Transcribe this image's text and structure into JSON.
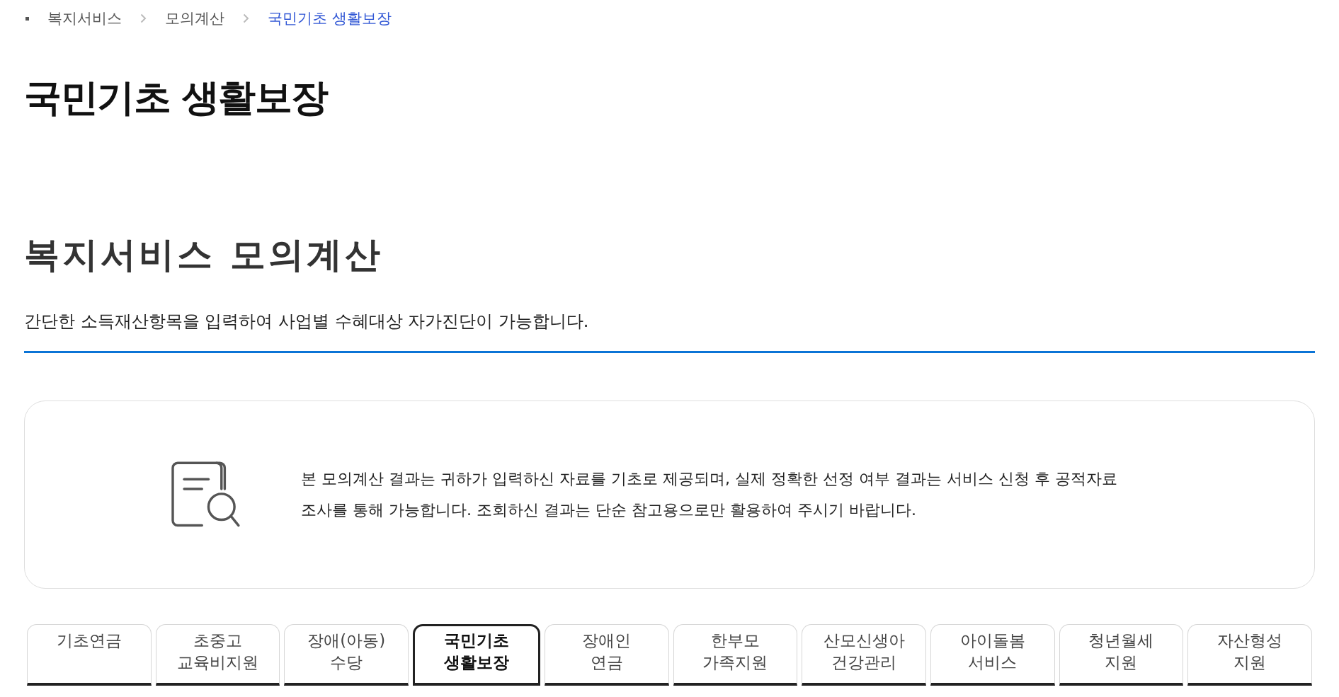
{
  "breadcrumb": [
    {
      "label": "복지서비스",
      "current": false
    },
    {
      "label": "모의계산",
      "current": false
    },
    {
      "label": "국민기초 생활보장",
      "current": true
    }
  ],
  "page_title": "국민기초 생활보장",
  "section": {
    "title": "복지서비스 모의계산",
    "description": "간단한 소득재산항목을 입력하여 사업별 수혜대상 자가진단이 가능합니다."
  },
  "notice": {
    "lines": [
      "본 모의계산 결과는 귀하가 입력하신 자료를 기초로 제공되며, 실제 정확한 선정 여부 결과는 서비스 신청 후 공적자료",
      "조사를 통해 가능합니다. 조회하신 결과는 단순 참고용으로만 활용하여 주시기 바랍니다."
    ]
  },
  "tabs": [
    {
      "lines": [
        "기초연금"
      ],
      "selected": false
    },
    {
      "lines": [
        "초중고",
        "교육비지원"
      ],
      "selected": false
    },
    {
      "lines": [
        "장애(아동)",
        "수당"
      ],
      "selected": false
    },
    {
      "lines": [
        "국민기초",
        "생활보장"
      ],
      "selected": true
    },
    {
      "lines": [
        "장애인",
        "연금"
      ],
      "selected": false
    },
    {
      "lines": [
        "한부모",
        "가족지원"
      ],
      "selected": false
    },
    {
      "lines": [
        "산모신생아",
        "건강관리"
      ],
      "selected": false
    },
    {
      "lines": [
        "아이돌봄",
        "서비스"
      ],
      "selected": false
    },
    {
      "lines": [
        "청년월세",
        "지원"
      ],
      "selected": false
    },
    {
      "lines": [
        "자산형성",
        "지원"
      ],
      "selected": false
    }
  ]
}
